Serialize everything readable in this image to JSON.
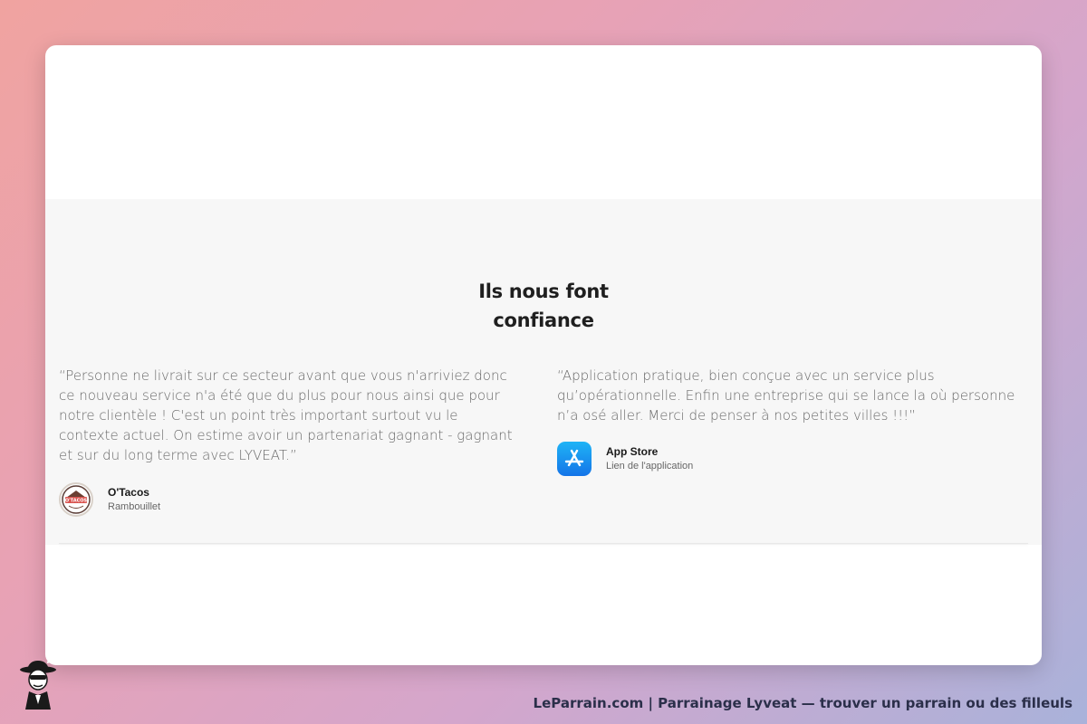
{
  "section": {
    "title_line1": "Ils nous font",
    "title_line2": "confiance"
  },
  "testimonials": [
    {
      "quote": "“Personne ne livrait sur ce secteur avant que vous n'arriviez donc ce nouveau service n'a été que du plus pour nous ainsi que pour notre clientèle ! C'est un point très important surtout vu le contexte actuel. On estime avoir un partenariat gagnant - gagnant et sur du long terme avec LYVEAT.”",
      "author_name": "O'Tacos",
      "author_sub": "Rambouillet",
      "icon": "otacos-logo-icon",
      "logo_text": "O'TACOS"
    },
    {
      "quote": "“Application pratique, bien conçue avec un service plus qu’opérationnelle. Enfin une entreprise qui se lance la où personne n’a osé aller. Merci de penser à nos petites villes !!!”",
      "author_name": "App Store",
      "author_sub": "Lien de l'application",
      "icon": "app-store-icon"
    }
  ],
  "footer": {
    "text": "LeParrain.com | Parrainage Lyveat — trouver un parrain ou des filleuls",
    "mascot_icon": "mascot-icon"
  },
  "colors": {
    "band_background": "#f7f7f7",
    "title": "#1f1f1f",
    "quote_text": "#6a6a6a",
    "app_store_blue": "#1474e8"
  }
}
